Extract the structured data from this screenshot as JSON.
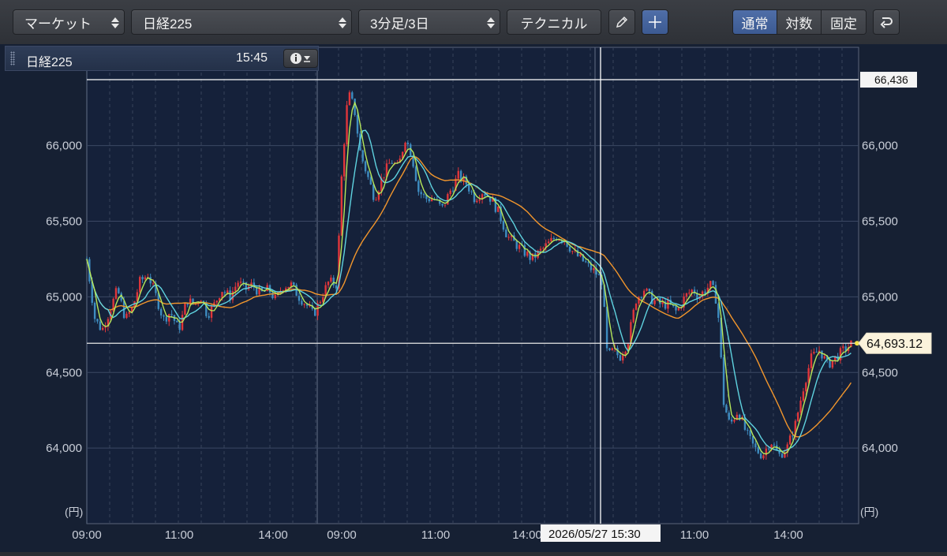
{
  "toolbar": {
    "market": {
      "label": "マーケット"
    },
    "symbol": {
      "label": "日経225"
    },
    "interval": {
      "label": "3分足/3日"
    },
    "technical": {
      "label": "テクニカル"
    },
    "pencil_icon": "pencil-icon",
    "crosshair_icon": "crosshair-icon",
    "scale_modes": [
      {
        "label": "通常",
        "active": true
      },
      {
        "label": "対数",
        "active": false
      },
      {
        "label": "固定",
        "active": false
      }
    ],
    "undo_icon": "undo-icon"
  },
  "info_bar": {
    "name": "日経225",
    "time": "15:45",
    "info_icon": "info-icon"
  },
  "chart_data": {
    "type": "candlestick",
    "y_ticks": [
      "66,000",
      "65,500",
      "65,000",
      "64,500",
      "64,000"
    ],
    "y_tick_values": [
      66000,
      65500,
      65000,
      64500,
      64000
    ],
    "ylim": [
      63500,
      66650
    ],
    "unit_label": "(円)",
    "x_tick_labels": [
      "09:00",
      "11:00",
      "14:00",
      "09:00",
      "11:00",
      "14:00",
      "11:00",
      "14:00"
    ],
    "crosshair": {
      "y_label": "66,436",
      "y_value": 66436,
      "x_label": "2026/05/27 15:30"
    },
    "last_price": {
      "label": "64,693.12",
      "value": 64693.12
    },
    "colors": {
      "up": "#e0363a",
      "down": "#3e8cc0",
      "ma_short": "#b6e85a",
      "ma_mid": "#5fd3e0",
      "ma_long": "#f2962c",
      "background": "#162033",
      "grid": "#33405a"
    },
    "close_path": [
      [
        0,
        65250
      ],
      [
        8,
        64850
      ],
      [
        15,
        64780
      ],
      [
        22,
        64900
      ],
      [
        30,
        65050
      ],
      [
        38,
        64850
      ],
      [
        45,
        64930
      ],
      [
        52,
        65100
      ],
      [
        60,
        65150
      ],
      [
        68,
        65000
      ],
      [
        75,
        64850
      ],
      [
        82,
        64900
      ],
      [
        90,
        64780
      ],
      [
        98,
        64980
      ],
      [
        105,
        64950
      ],
      [
        112,
        65000
      ],
      [
        118,
        64880
      ],
      [
        125,
        64950
      ],
      [
        132,
        65050
      ],
      [
        140,
        65000
      ],
      [
        148,
        65100
      ],
      [
        155,
        65050
      ],
      [
        162,
        65080
      ],
      [
        170,
        65020
      ],
      [
        178,
        65050
      ],
      [
        185,
        64980
      ],
      [
        192,
        65070
      ],
      [
        200,
        65080
      ],
      [
        208,
        65000
      ],
      [
        215,
        64950
      ],
      [
        222,
        64880
      ],
      [
        230,
        65000
      ],
      [
        237,
        65100
      ],
      [
        245,
        65080
      ],
      [
        250,
        65850
      ],
      [
        256,
        66350
      ],
      [
        262,
        66250
      ],
      [
        268,
        65950
      ],
      [
        275,
        65800
      ],
      [
        282,
        65650
      ],
      [
        290,
        65800
      ],
      [
        298,
        65900
      ],
      [
        305,
        65850
      ],
      [
        312,
        66050
      ],
      [
        318,
        65950
      ],
      [
        325,
        65700
      ],
      [
        332,
        65650
      ],
      [
        340,
        65650
      ],
      [
        348,
        65580
      ],
      [
        356,
        65700
      ],
      [
        364,
        65800
      ],
      [
        372,
        65750
      ],
      [
        380,
        65650
      ],
      [
        388,
        65700
      ],
      [
        396,
        65650
      ],
      [
        404,
        65550
      ],
      [
        412,
        65400
      ],
      [
        420,
        65350
      ],
      [
        428,
        65300
      ],
      [
        436,
        65250
      ],
      [
        444,
        65300
      ],
      [
        452,
        65350
      ],
      [
        460,
        65400
      ],
      [
        468,
        65380
      ],
      [
        476,
        65300
      ],
      [
        484,
        65250
      ],
      [
        492,
        65200
      ],
      [
        500,
        65150
      ],
      [
        505,
        65100
      ],
      [
        510,
        64600
      ],
      [
        516,
        64650
      ],
      [
        522,
        64600
      ],
      [
        530,
        64700
      ],
      [
        538,
        64980
      ],
      [
        546,
        65050
      ],
      [
        554,
        64980
      ],
      [
        562,
        64950
      ],
      [
        570,
        64950
      ],
      [
        578,
        64900
      ],
      [
        586,
        65000
      ],
      [
        594,
        65050
      ],
      [
        600,
        65000
      ],
      [
        606,
        65050
      ],
      [
        612,
        65080
      ],
      [
        618,
        64950
      ],
      [
        624,
        64300
      ],
      [
        630,
        64150
      ],
      [
        638,
        64250
      ],
      [
        646,
        64100
      ],
      [
        654,
        64000
      ],
      [
        662,
        63950
      ],
      [
        670,
        64050
      ],
      [
        678,
        63950
      ],
      [
        686,
        64000
      ],
      [
        694,
        64150
      ],
      [
        702,
        64400
      ],
      [
        710,
        64600
      ],
      [
        718,
        64650
      ],
      [
        726,
        64550
      ],
      [
        734,
        64600
      ],
      [
        742,
        64650
      ],
      [
        750,
        64693.12
      ]
    ]
  }
}
